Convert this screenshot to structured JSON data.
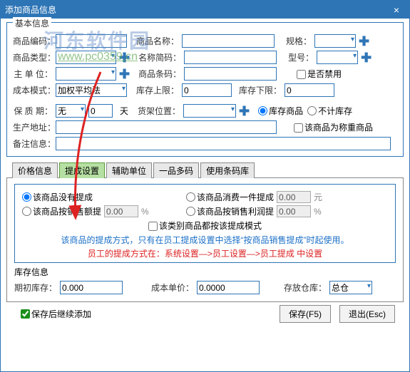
{
  "titlebar": {
    "title": "添加商品信息",
    "close": "×"
  },
  "watermark": {
    "text": "河东软件园",
    "url": "www.pc0359.cn"
  },
  "group_basic_label": "基本信息",
  "fields": {
    "code_label": "商品编码：",
    "code_val": "",
    "name_label": "商品名称：",
    "name_val": "",
    "spec_label": "规格：",
    "spec_val": "",
    "type_label": "商品类型：",
    "type_val": "",
    "short_label": "名称简码：",
    "short_val": "",
    "model_label": "型号：",
    "model_val": "",
    "unit_label": "主 单 位：",
    "unit_val": "",
    "barcode_label": "商品条码：",
    "barcode_val": "",
    "disable_label": "是否禁用",
    "costmode_label": "成本模式：",
    "costmode_val": "加权平均法",
    "upper_label": "库存上限：",
    "upper_val": "0",
    "lower_label": "库存下限：",
    "lower_val": "0",
    "shelf_label": "保 质 期：",
    "shelf_sel": "无",
    "shelf_num": "0",
    "shelf_unit": "天",
    "loc_label": "货架位置：",
    "loc_val": "",
    "stock_radio1": "库存商品",
    "stock_radio2": "不计库存",
    "addr_label": "生产地址：",
    "addr_val": "",
    "weigh_label": "该商品为称重商品",
    "remark_label": "备注信息：",
    "remark_val": ""
  },
  "tabs": {
    "t1": "价格信息",
    "t2": "提成设置",
    "t3": "辅助单位",
    "t4": "一品多码",
    "t5": "使用条码库"
  },
  "commission": {
    "r1": "该商品没有提成",
    "r2": "该商品消费一件提成",
    "r2_val": "0.00",
    "r2_unit": "元",
    "r3": "该商品按销售额提",
    "r3_val": "0.00",
    "r3_unit": "%",
    "r4": "该商品按销售利润提",
    "r4_val": "0.00",
    "r4_unit": "%",
    "chk": "该类别商品都按该提成模式",
    "note_blue": "该商品的提成方式，只有在员工提成设置中选择“按商品销售提成”时起使用。",
    "note_red": "员工的提成方式在：系统设置—>员工设置—>员工提成  中设置"
  },
  "stock": {
    "label": "库存信息",
    "init_label": "期初库存：",
    "init_val": "0.000",
    "price_label": "成本单价：",
    "price_val": "0.0000",
    "wh_label": "存放仓库：",
    "wh_val": "总仓"
  },
  "footer": {
    "cont_label": "保存后继续添加",
    "save": "保存(F5)",
    "exit": "退出(Esc)"
  }
}
